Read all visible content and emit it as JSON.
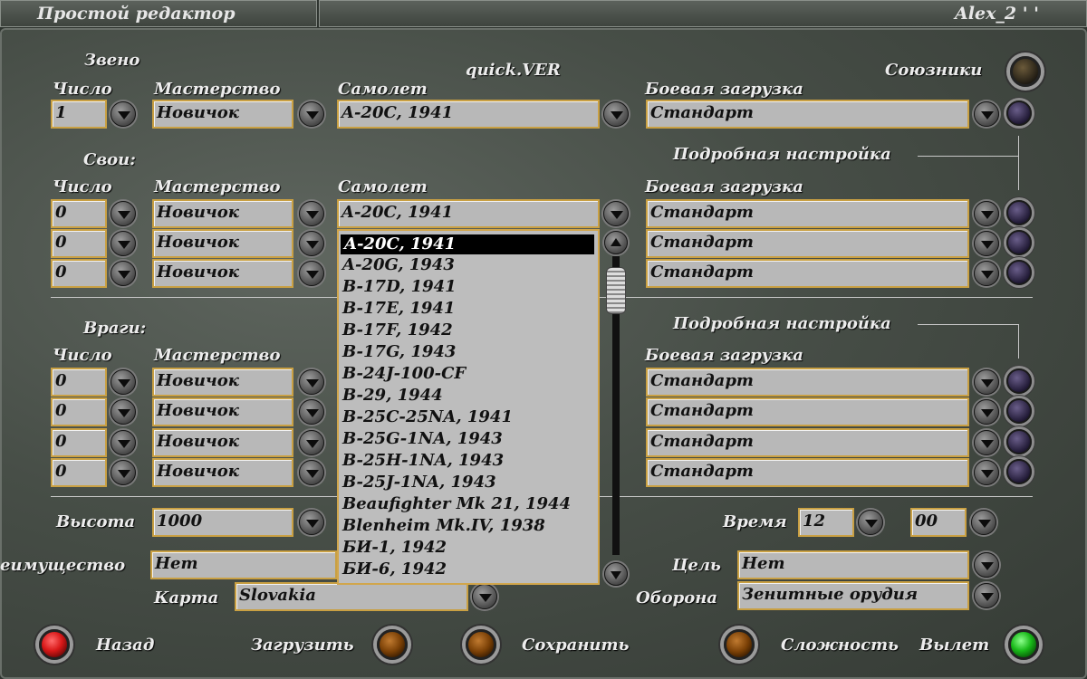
{
  "window": {
    "title_left": "Простой редактор",
    "title_right": "Alex_2 ' '"
  },
  "mission_name": "quick.VER",
  "allies_label": "Союзники",
  "headers": {
    "count": "Число",
    "skill": "Мастерство",
    "plane": "Самолет",
    "loadout": "Боевая загрузка",
    "advanced": "Подробная настройка"
  },
  "flight": {
    "label": "Звено",
    "count": "1",
    "skill": "Новичок",
    "plane": "A-20C, 1941",
    "loadout": "Стандарт"
  },
  "friendly": {
    "label": "Свои:",
    "rows": [
      {
        "count": "0",
        "skill": "Новичок",
        "plane": "A-20C, 1941",
        "loadout": "Стандарт"
      },
      {
        "count": "0",
        "skill": "Новичок",
        "loadout": "Стандарт"
      },
      {
        "count": "0",
        "skill": "Новичок",
        "loadout": "Стандарт"
      }
    ]
  },
  "enemies": {
    "label": "Враги:",
    "rows": [
      {
        "count": "0",
        "skill": "Новичок",
        "loadout": "Стандарт"
      },
      {
        "count": "0",
        "skill": "Новичок",
        "loadout": "Стандарт"
      },
      {
        "count": "0",
        "skill": "Новичок",
        "loadout": "Стандарт"
      },
      {
        "count": "0",
        "skill": "Новичок",
        "loadout": "Стандарт"
      }
    ]
  },
  "plane_dropdown": {
    "selected_index": 0,
    "items": [
      "A-20C, 1941",
      "A-20G, 1943",
      "B-17D, 1941",
      "B-17E, 1941",
      "B-17F, 1942",
      "B-17G, 1943",
      "B-24J-100-CF",
      "B-29, 1944",
      "B-25C-25NA, 1941",
      "B-25G-1NA, 1943",
      "B-25H-1NA, 1943",
      "B-25J-1NA, 1943",
      "Beaufighter Mk 21, 1944",
      "Blenheim Mk.IV, 1938",
      "БИ-1, 1942",
      "БИ-6, 1942"
    ]
  },
  "altitude": {
    "label": "Высота",
    "value": "1000"
  },
  "advantage": {
    "label": "еимущество",
    "value": "Нет"
  },
  "map": {
    "label": "Карта",
    "value": "Slovakia"
  },
  "time": {
    "label": "Время",
    "hour": "12",
    "minute": "00"
  },
  "target": {
    "label": "Цель",
    "value": "Нет"
  },
  "defense": {
    "label": "Оборона",
    "value": "Зенитные орудия"
  },
  "footer": {
    "back": "Назад",
    "load": "Загрузить",
    "save": "Сохранить",
    "difficulty": "Сложность",
    "fly": "Вылет"
  },
  "colors": {
    "field_bg": "#b8b8b8",
    "field_border": "#c9a043",
    "panel_bg": "#474e47",
    "lamp_red": "#d81818",
    "lamp_amber": "#7a4006",
    "lamp_green": "#18b818"
  }
}
